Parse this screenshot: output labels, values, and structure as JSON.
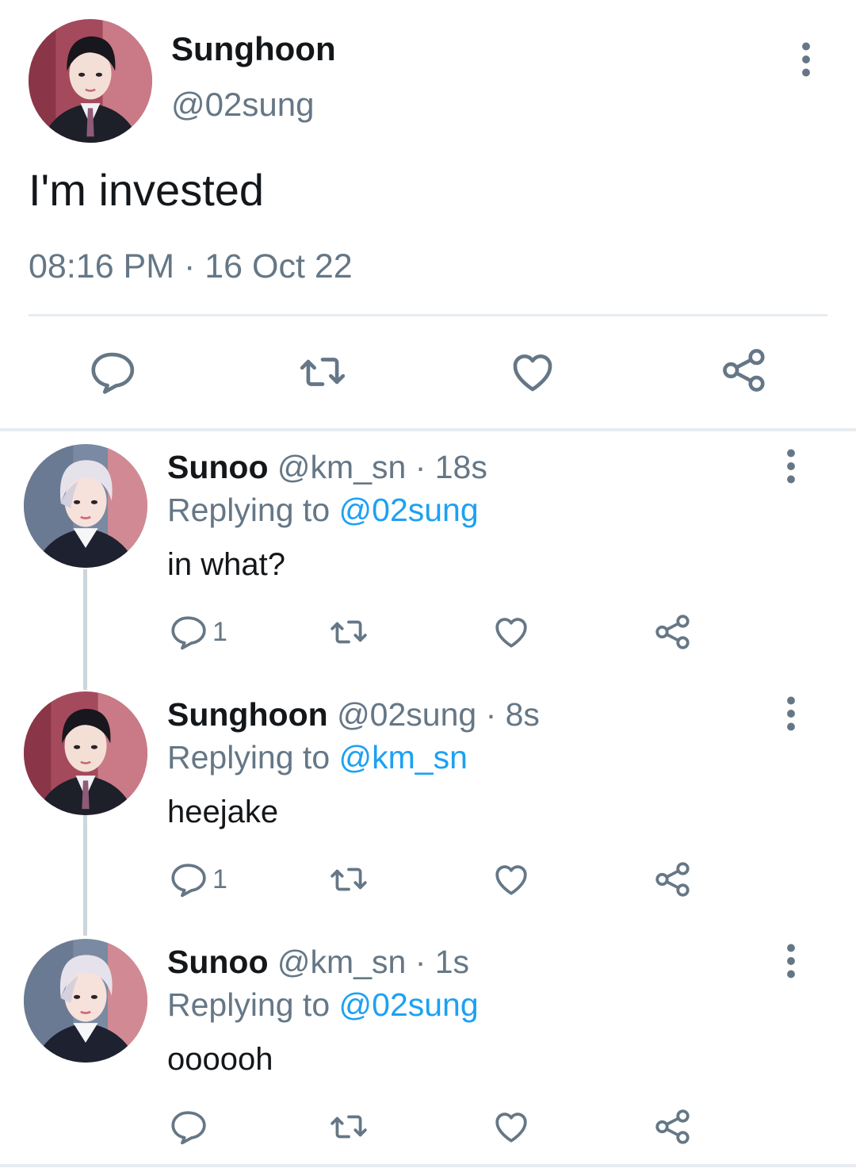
{
  "main_tweet": {
    "author_name": "Sunghoon",
    "author_handle": "@02sung",
    "text": "I'm invested",
    "timestamp": "08:16 PM · 16 Oct 22",
    "avatar_icon": "avatar-sunghoon",
    "more_icon": "more-vertical-icon",
    "actions": [
      "reply-icon",
      "retweet-icon",
      "like-icon",
      "share-icon"
    ]
  },
  "replies": [
    {
      "author_name": "Sunoo",
      "meta": " @km_sn · 18s",
      "replying_label": "Replying to ",
      "replying_to": "@02sung",
      "text": "in what?",
      "reply_count": "1"
    },
    {
      "author_name": "Sunghoon",
      "meta": " @02sung · 8s",
      "replying_label": "Replying to ",
      "replying_to": "@km_sn",
      "text": "heejake",
      "reply_count": "1"
    },
    {
      "author_name": "Sunoo",
      "meta": " @km_sn · 1s",
      "replying_label": "Replying to ",
      "replying_to": "@02sung",
      "text": "oooooh",
      "reply_count": ""
    }
  ],
  "colors": {
    "text_primary": "#14171a",
    "text_secondary": "#657786",
    "mention": "#1da1f2",
    "divider": "#e6ecf0",
    "thread_line": "#ccd6dd"
  }
}
